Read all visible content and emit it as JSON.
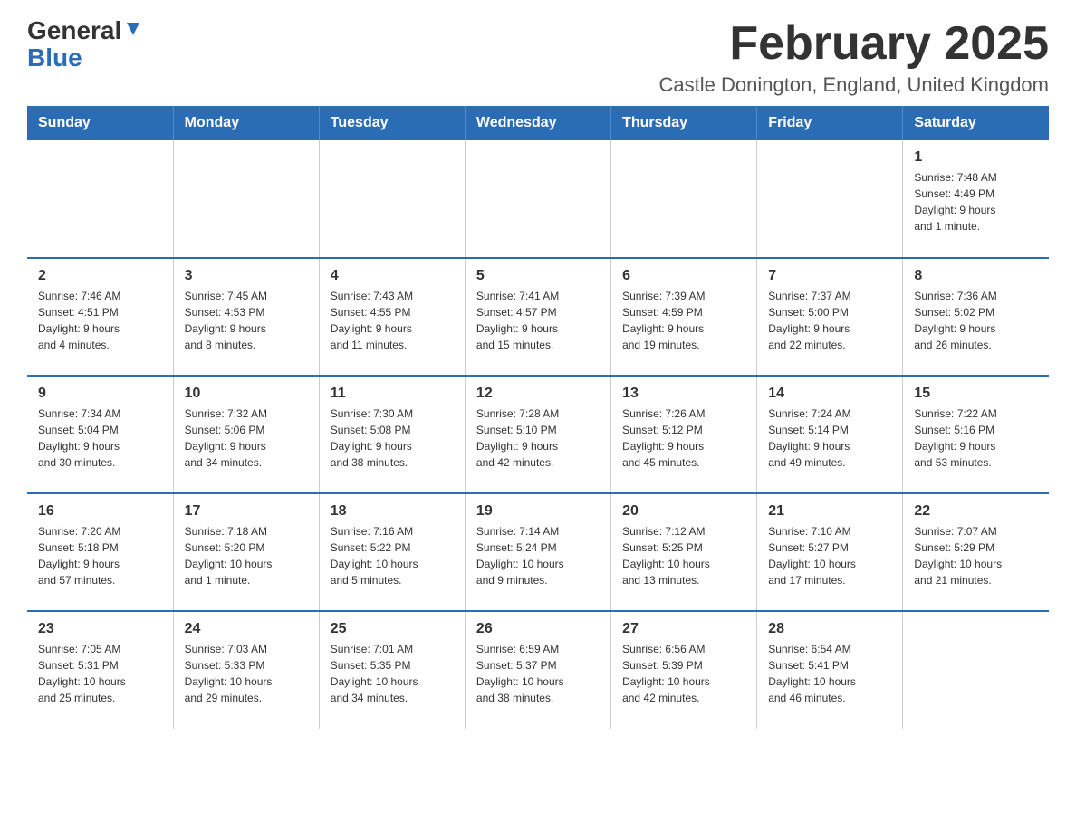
{
  "logo": {
    "text_general": "General",
    "text_blue": "Blue"
  },
  "title": "February 2025",
  "subtitle": "Castle Donington, England, United Kingdom",
  "days_of_week": [
    "Sunday",
    "Monday",
    "Tuesday",
    "Wednesday",
    "Thursday",
    "Friday",
    "Saturday"
  ],
  "weeks": [
    [
      {
        "day": "",
        "info": ""
      },
      {
        "day": "",
        "info": ""
      },
      {
        "day": "",
        "info": ""
      },
      {
        "day": "",
        "info": ""
      },
      {
        "day": "",
        "info": ""
      },
      {
        "day": "",
        "info": ""
      },
      {
        "day": "1",
        "info": "Sunrise: 7:48 AM\nSunset: 4:49 PM\nDaylight: 9 hours\nand 1 minute."
      }
    ],
    [
      {
        "day": "2",
        "info": "Sunrise: 7:46 AM\nSunset: 4:51 PM\nDaylight: 9 hours\nand 4 minutes."
      },
      {
        "day": "3",
        "info": "Sunrise: 7:45 AM\nSunset: 4:53 PM\nDaylight: 9 hours\nand 8 minutes."
      },
      {
        "day": "4",
        "info": "Sunrise: 7:43 AM\nSunset: 4:55 PM\nDaylight: 9 hours\nand 11 minutes."
      },
      {
        "day": "5",
        "info": "Sunrise: 7:41 AM\nSunset: 4:57 PM\nDaylight: 9 hours\nand 15 minutes."
      },
      {
        "day": "6",
        "info": "Sunrise: 7:39 AM\nSunset: 4:59 PM\nDaylight: 9 hours\nand 19 minutes."
      },
      {
        "day": "7",
        "info": "Sunrise: 7:37 AM\nSunset: 5:00 PM\nDaylight: 9 hours\nand 22 minutes."
      },
      {
        "day": "8",
        "info": "Sunrise: 7:36 AM\nSunset: 5:02 PM\nDaylight: 9 hours\nand 26 minutes."
      }
    ],
    [
      {
        "day": "9",
        "info": "Sunrise: 7:34 AM\nSunset: 5:04 PM\nDaylight: 9 hours\nand 30 minutes."
      },
      {
        "day": "10",
        "info": "Sunrise: 7:32 AM\nSunset: 5:06 PM\nDaylight: 9 hours\nand 34 minutes."
      },
      {
        "day": "11",
        "info": "Sunrise: 7:30 AM\nSunset: 5:08 PM\nDaylight: 9 hours\nand 38 minutes."
      },
      {
        "day": "12",
        "info": "Sunrise: 7:28 AM\nSunset: 5:10 PM\nDaylight: 9 hours\nand 42 minutes."
      },
      {
        "day": "13",
        "info": "Sunrise: 7:26 AM\nSunset: 5:12 PM\nDaylight: 9 hours\nand 45 minutes."
      },
      {
        "day": "14",
        "info": "Sunrise: 7:24 AM\nSunset: 5:14 PM\nDaylight: 9 hours\nand 49 minutes."
      },
      {
        "day": "15",
        "info": "Sunrise: 7:22 AM\nSunset: 5:16 PM\nDaylight: 9 hours\nand 53 minutes."
      }
    ],
    [
      {
        "day": "16",
        "info": "Sunrise: 7:20 AM\nSunset: 5:18 PM\nDaylight: 9 hours\nand 57 minutes."
      },
      {
        "day": "17",
        "info": "Sunrise: 7:18 AM\nSunset: 5:20 PM\nDaylight: 10 hours\nand 1 minute."
      },
      {
        "day": "18",
        "info": "Sunrise: 7:16 AM\nSunset: 5:22 PM\nDaylight: 10 hours\nand 5 minutes."
      },
      {
        "day": "19",
        "info": "Sunrise: 7:14 AM\nSunset: 5:24 PM\nDaylight: 10 hours\nand 9 minutes."
      },
      {
        "day": "20",
        "info": "Sunrise: 7:12 AM\nSunset: 5:25 PM\nDaylight: 10 hours\nand 13 minutes."
      },
      {
        "day": "21",
        "info": "Sunrise: 7:10 AM\nSunset: 5:27 PM\nDaylight: 10 hours\nand 17 minutes."
      },
      {
        "day": "22",
        "info": "Sunrise: 7:07 AM\nSunset: 5:29 PM\nDaylight: 10 hours\nand 21 minutes."
      }
    ],
    [
      {
        "day": "23",
        "info": "Sunrise: 7:05 AM\nSunset: 5:31 PM\nDaylight: 10 hours\nand 25 minutes."
      },
      {
        "day": "24",
        "info": "Sunrise: 7:03 AM\nSunset: 5:33 PM\nDaylight: 10 hours\nand 29 minutes."
      },
      {
        "day": "25",
        "info": "Sunrise: 7:01 AM\nSunset: 5:35 PM\nDaylight: 10 hours\nand 34 minutes."
      },
      {
        "day": "26",
        "info": "Sunrise: 6:59 AM\nSunset: 5:37 PM\nDaylight: 10 hours\nand 38 minutes."
      },
      {
        "day": "27",
        "info": "Sunrise: 6:56 AM\nSunset: 5:39 PM\nDaylight: 10 hours\nand 42 minutes."
      },
      {
        "day": "28",
        "info": "Sunrise: 6:54 AM\nSunset: 5:41 PM\nDaylight: 10 hours\nand 46 minutes."
      },
      {
        "day": "",
        "info": ""
      }
    ]
  ],
  "colors": {
    "header_bg": "#2a6db5",
    "header_text": "#ffffff",
    "border": "#2a6db5"
  }
}
